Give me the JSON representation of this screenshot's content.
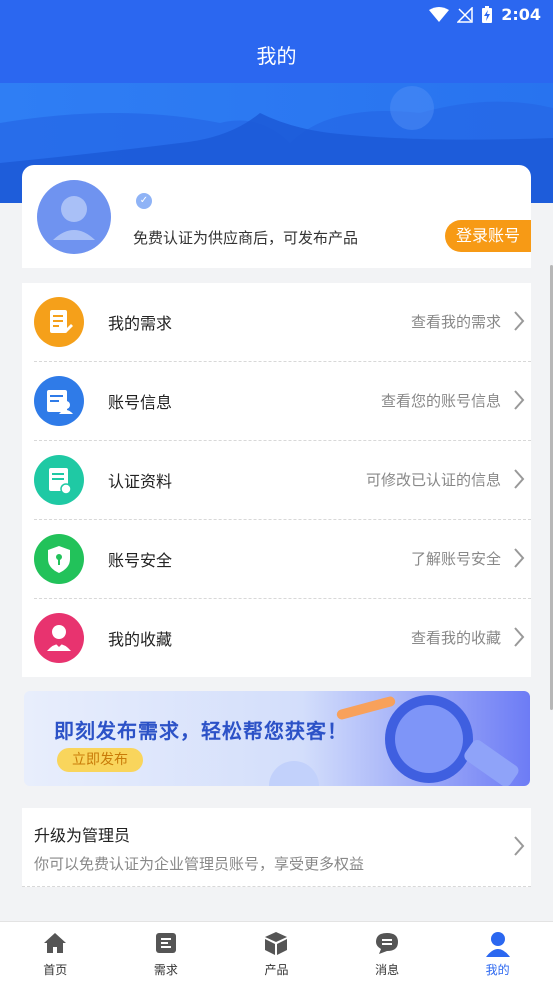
{
  "status_bar": {
    "time": "2:04",
    "icons": [
      "wifi-icon",
      "no-signal-icon",
      "battery-charging-icon"
    ]
  },
  "header": {
    "title": "我的"
  },
  "profile": {
    "hint": "免费认证为供应商后，可发布产品",
    "login_button": "登录账号"
  },
  "menu": {
    "items": [
      {
        "label": "我的需求",
        "hint": "查看我的需求",
        "icon": "document-edit-icon",
        "color": "#f5a01a"
      },
      {
        "label": "账号信息",
        "hint": "查看您的账号信息",
        "icon": "account-info-icon",
        "color": "#2f7be8"
      },
      {
        "label": "认证资料",
        "hint": "可修改已认证的信息",
        "icon": "certificate-icon",
        "color": "#1fc9a4"
      },
      {
        "label": "账号安全",
        "hint": "了解账号安全",
        "icon": "shield-icon",
        "color": "#22c25a"
      },
      {
        "label": "我的收藏",
        "hint": "查看我的收藏",
        "icon": "favorite-user-icon",
        "color": "#e8336f"
      }
    ]
  },
  "banner": {
    "title": "即刻发布需求，轻松帮您获客！",
    "button": "立即发布"
  },
  "upgrade": {
    "title": "升级为管理员",
    "subtitle": "你可以免费认证为企业管理员账号，享受更多权益"
  },
  "tabbar": {
    "tabs": [
      {
        "label": "首页",
        "icon": "home-icon"
      },
      {
        "label": "需求",
        "icon": "list-icon"
      },
      {
        "label": "产品",
        "icon": "box-icon"
      },
      {
        "label": "消息",
        "icon": "message-icon"
      },
      {
        "label": "我的",
        "icon": "user-icon",
        "active": true
      }
    ]
  },
  "colors": {
    "primary": "#2b67f0",
    "accent_orange": "#f79a15"
  }
}
